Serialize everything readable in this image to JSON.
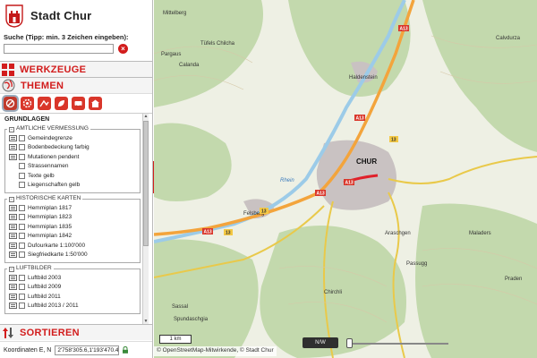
{
  "brand": {
    "title": "Stadt Chur"
  },
  "search": {
    "hint": "Suche (Tipp: min. 3 Zeichen eingeben):",
    "value": "",
    "clear_label": "×"
  },
  "panels": {
    "werkzeuge": "WERKZEUGE",
    "themen": "THEMEN",
    "sortieren": "SORTIEREN"
  },
  "theme_icons": [
    "theme-vermessung-icon",
    "theme-werkleitungen-icon",
    "theme-planung-icon",
    "theme-umwelt-icon",
    "theme-verkehr-icon",
    "theme-gebaeude-icon"
  ],
  "layers": {
    "title": "GRUNDLAGEN",
    "groups": [
      {
        "name": "AMTLICHE VERMESSUNG",
        "items": [
          {
            "label": "Gemeindegrenze",
            "indent": false
          },
          {
            "label": "Bodenbedeckung farbig",
            "indent": false
          },
          {
            "label": "Mutationen pendent",
            "indent": false
          },
          {
            "label": "Strassennamen",
            "indent": true
          },
          {
            "label": "Texte gelb",
            "indent": true
          },
          {
            "label": "Liegenschaften gelb",
            "indent": true
          }
        ]
      },
      {
        "name": "HISTORISCHE KARTEN",
        "items": [
          {
            "label": "Hemmiplan 1817",
            "indent": false
          },
          {
            "label": "Hemmiplan 1823",
            "indent": false
          },
          {
            "label": "Hemmiplan 1835",
            "indent": false
          },
          {
            "label": "Hemmiplan 1842",
            "indent": false
          },
          {
            "label": "Dufourkarte 1:100'000",
            "indent": false
          },
          {
            "label": "Siegfriedkarte 1:50'000",
            "indent": false
          }
        ]
      },
      {
        "name": "LUFTBILDER",
        "items": [
          {
            "label": "Luftbild 2003",
            "indent": false
          },
          {
            "label": "Luftbild 2009",
            "indent": false
          },
          {
            "label": "Luftbild 2011",
            "indent": false
          },
          {
            "label": "Luftbild 2013 / 2011",
            "indent": false
          }
        ]
      }
    ]
  },
  "coords": {
    "label": "Koordinaten E, N",
    "value": "2'758'305.6,1'193'470.4"
  },
  "collapse_label": "|||",
  "map": {
    "place_labels": [
      "Mittelberg",
      "Tüfels Chilcha",
      "Pargaus",
      "Calanda",
      "Haldenstein",
      "CHUR",
      "Felsberg",
      "Rhein",
      "Araschgen",
      "Passugg",
      "Maladers",
      "Sassal",
      "Spundaschgia",
      "Praden",
      "Chirchli",
      "Calvdurza"
    ],
    "road_labels": [
      "A13",
      "A13",
      "A13",
      "A13",
      "A13",
      "13",
      "13",
      "13"
    ],
    "scale_label": "1 km",
    "attribution": "© OpenStreetMap-Mitwirkende, © Stadt Chur",
    "north_button": "N/W",
    "opacity_value": 0.0,
    "colors": {
      "brand_red": "#d21c1c",
      "forest": "#c3d9ad",
      "meadow": "#eef0e4",
      "river": "#9ccbe8",
      "motorway": "#f3a43c",
      "settlement": "#c9c2c2"
    }
  }
}
